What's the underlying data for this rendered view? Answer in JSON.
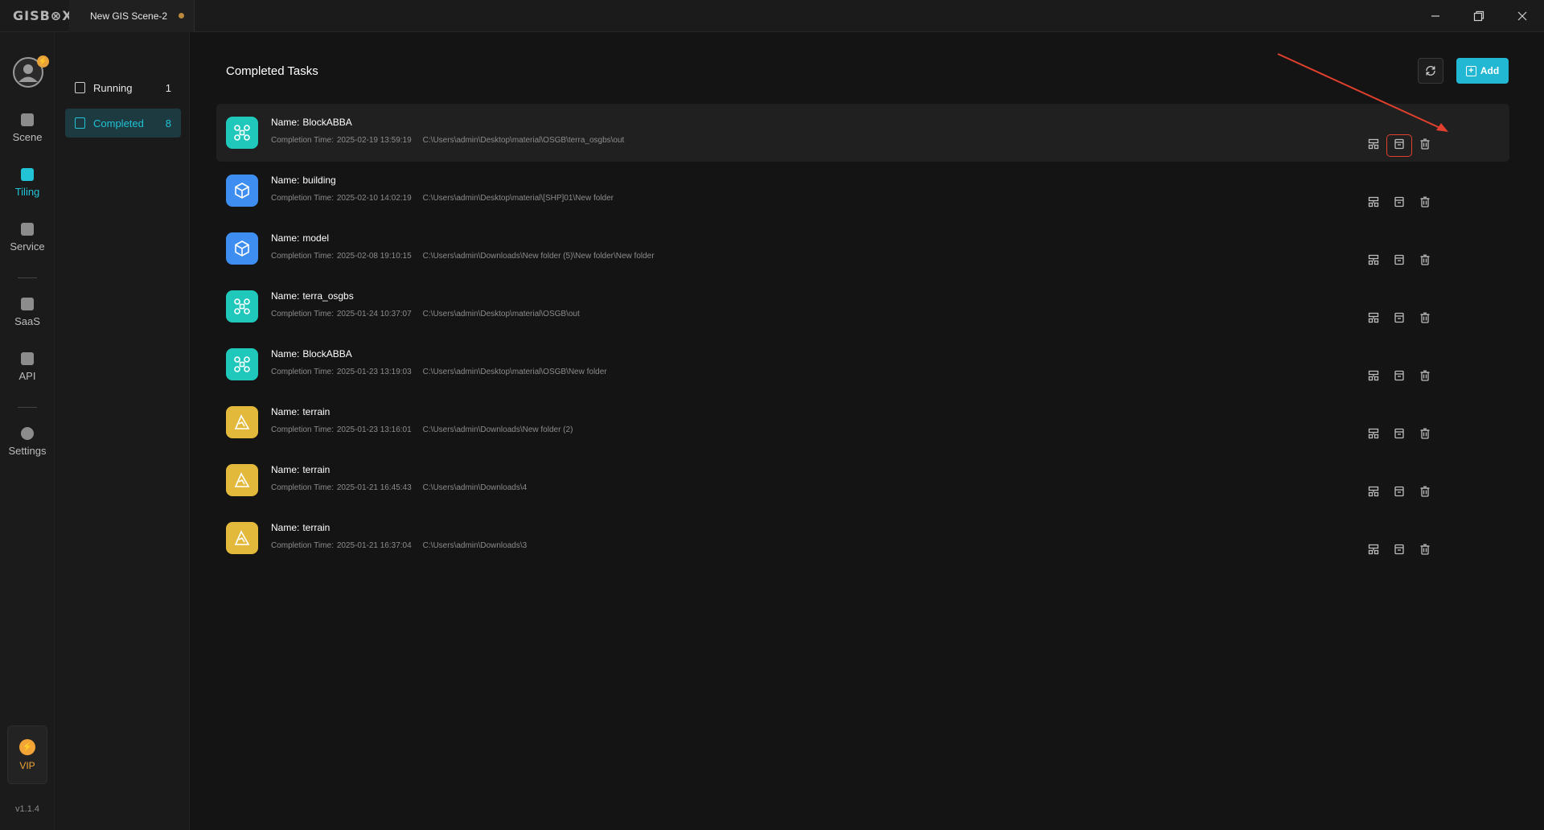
{
  "app": {
    "logo": "GISB⊗X",
    "scene_tab": "New GIS Scene-2"
  },
  "window_controls": [
    "minimize",
    "restore",
    "close"
  ],
  "leftnav": {
    "items": [
      {
        "label": "Scene",
        "icon": "scene-icon"
      },
      {
        "label": "Tiling",
        "icon": "tiling-icon",
        "active": true
      },
      {
        "label": "Service",
        "icon": "service-icon"
      },
      {
        "label": "SaaS",
        "icon": "saas-icon"
      },
      {
        "label": "API",
        "icon": "api-icon"
      },
      {
        "label": "Settings",
        "icon": "settings-icon"
      }
    ],
    "vip_label": "VIP",
    "version": "v1.1.4"
  },
  "subnav": {
    "items": [
      {
        "label": "Running",
        "count": "1"
      },
      {
        "label": "Completed",
        "count": "8",
        "active": true
      }
    ]
  },
  "main": {
    "title": "Completed Tasks",
    "add_label": "Add",
    "name_prefix": "Name:",
    "time_prefix": "Completion Time:",
    "tasks": [
      {
        "name": "BlockABBA",
        "time": "2025-02-19 13:59:19",
        "path": "C:\\Users\\admin\\Desktop\\material\\OSGB\\terra_osgbs\\out",
        "icon": "drone-icon",
        "color": "#20c8bc"
      },
      {
        "name": "building",
        "time": "2025-02-10 14:02:19",
        "path": "C:\\Users\\admin\\Desktop\\material\\[SHP]01\\New folder",
        "icon": "cube-icon",
        "color": "#3d8ef0"
      },
      {
        "name": "model",
        "time": "2025-02-08 19:10:15",
        "path": "C:\\Users\\admin\\Downloads\\New folder (5)\\New folder\\New folder",
        "icon": "cube-icon",
        "color": "#3d8ef0"
      },
      {
        "name": "terra_osgbs",
        "time": "2025-01-24 10:37:07",
        "path": "C:\\Users\\admin\\Desktop\\material\\OSGB\\out",
        "icon": "drone-icon",
        "color": "#20c8bc"
      },
      {
        "name": "BlockABBA",
        "time": "2025-01-23 13:19:03",
        "path": "C:\\Users\\admin\\Desktop\\material\\OSGB\\New folder",
        "icon": "drone-icon",
        "color": "#20c8bc"
      },
      {
        "name": "terrain",
        "time": "2025-01-23 13:16:01",
        "path": "C:\\Users\\admin\\Downloads\\New folder (2)",
        "icon": "terrain-icon",
        "color": "#e3b93c"
      },
      {
        "name": "terrain",
        "time": "2025-01-21 16:45:43",
        "path": "C:\\Users\\admin\\Downloads\\4",
        "icon": "terrain-icon",
        "color": "#e3b93c"
      },
      {
        "name": "terrain",
        "time": "2025-01-21 16:37:04",
        "path": "C:\\Users\\admin\\Downloads\\3",
        "icon": "terrain-icon",
        "color": "#e3b93c"
      }
    ],
    "row_actions": [
      "publish-icon",
      "log-icon",
      "delete-icon"
    ]
  },
  "colors": {
    "accent": "#22b8d3",
    "annotation": "#e0402d",
    "vip": "#f2a437"
  }
}
